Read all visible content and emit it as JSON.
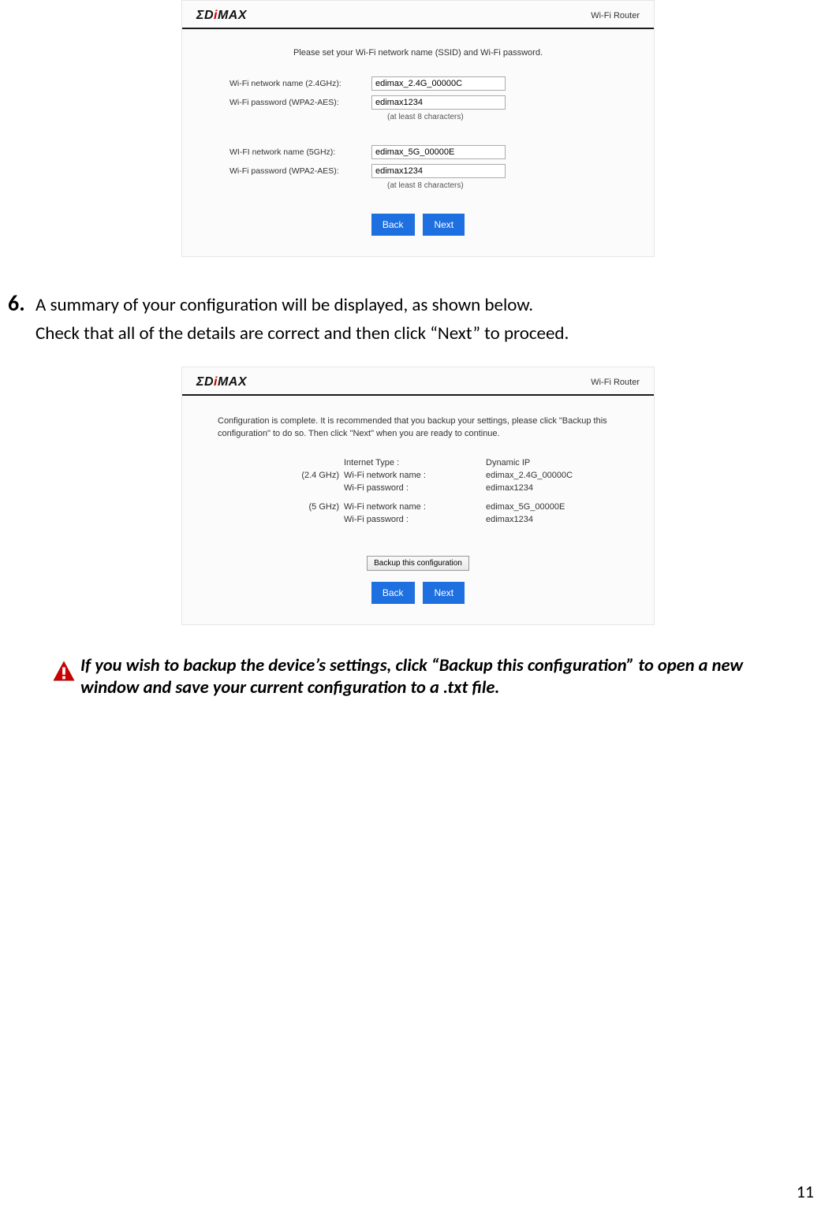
{
  "page_number": "11",
  "step6": {
    "number": "6.",
    "text_a": "A summary of your configuration will be displayed, as shown below.",
    "text_b": "Check that all of the details are correct and then click “Next” to proceed."
  },
  "note": "If you wish to backup the device’s settings, click “Backup this configuration” to open a new window and save your current configuration to a .txt file.",
  "s1": {
    "mode": "Wi-Fi Router",
    "instruction": "Please set your Wi-Fi network name (SSID) and Wi-Fi password.",
    "g24": {
      "name_label": "Wi-Fi network name (2.4GHz):",
      "name_val": "edimax_2.4G_00000C",
      "pass_label": "Wi-Fi password (WPA2-AES):",
      "pass_val": "edimax1234",
      "hint": "(at least 8 characters)"
    },
    "g5": {
      "name_label": "WI-FI network name (5GHz):",
      "name_val": "edimax_5G_00000E",
      "pass_label": "Wi-Fi password (WPA2-AES):",
      "pass_val": "edimax1234",
      "hint": "(at least 8 characters)"
    },
    "back": "Back",
    "next": "Next"
  },
  "s2": {
    "mode": "Wi-Fi Router",
    "instruction": "Configuration is complete. It is recommended that you backup your settings, please click \"Backup this configuration\" to do so. Then click \"Next\" when you are ready to continue.",
    "internet_type_label": "Internet Type :",
    "internet_type_val": "Dynamic IP",
    "band24": "(2.4 GHz)",
    "band5": "(5 GHz)",
    "name_label": "Wi-Fi network name :",
    "pass_label": "Wi-Fi password :",
    "name24": "edimax_2.4G_00000C",
    "pass24": "edimax1234",
    "name5": "edimax_5G_00000E",
    "pass5": "edimax1234",
    "backup": "Backup this configuration",
    "back": "Back",
    "next": "Next"
  }
}
